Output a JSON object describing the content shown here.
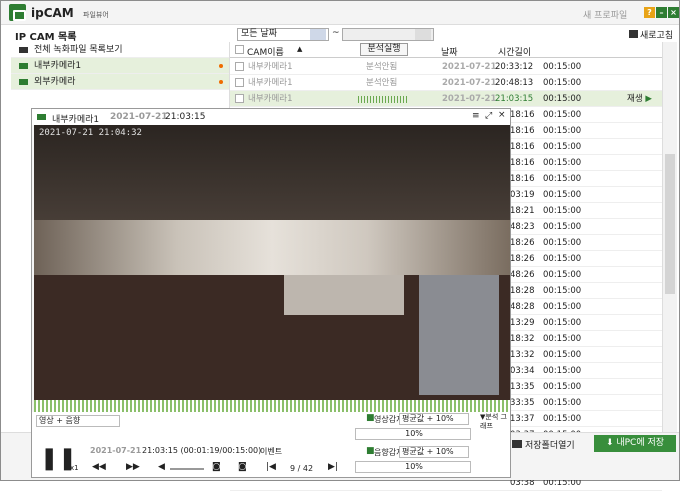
{
  "app": {
    "name": "ipCAM",
    "subtitle": "파일뷰어",
    "new_program": "새 프로파일"
  },
  "toolbar": {
    "list_label": "IP CAM 목록",
    "date_filter": "모든 날짜",
    "tilde": "~",
    "refresh": "새로고침"
  },
  "cameras": [
    {
      "label": "전체 녹화파일 목록보기",
      "selected": false
    },
    {
      "label": "내부카메라1",
      "selected": true
    },
    {
      "label": "외부카메라",
      "selected": true
    }
  ],
  "table": {
    "col_cam": "CAM이름",
    "col_analysis": "분석실행",
    "col_date": "날짜",
    "col_length": "시간길이"
  },
  "rows": [
    {
      "cam": "내부카메라1",
      "analysis": "분석안됨",
      "date": "2021-07-21",
      "time": "20:33:12",
      "length": "00:15:00"
    },
    {
      "cam": "내부카메라1",
      "analysis": "분석안됨",
      "date": "2021-07-21",
      "time": "20:48:13",
      "length": "00:15:00"
    },
    {
      "cam": "내부카메라1",
      "analysis": "",
      "date": "2021-07-21",
      "time": "21:03:15",
      "length": "00:15:00",
      "play": "재생"
    }
  ],
  "extra_times": [
    "18:16",
    "18:16",
    "18:16",
    "18:16",
    "18:16",
    "03:19",
    "18:21",
    "48:23",
    "18:26",
    "18:26",
    "48:26",
    "18:28",
    "48:28",
    "13:29",
    "18:32",
    "13:32",
    "03:34",
    "13:35",
    "33:35",
    "13:37",
    "03:37",
    "48:37",
    "03:38",
    "03:38"
  ],
  "extra_length": "00:15:00",
  "bottom": {
    "open_folder": "저장폴더열기",
    "save_pc": "내PC에 저장"
  },
  "player": {
    "cam": "내부카메라1",
    "date": "2021-07-21",
    "time": "21:03:15",
    "overlay": "2021-07-21  21:04:32",
    "mode": "영상 + 음향",
    "clock": "21:03:15 (00:01:19/00:15:00)",
    "event_label": "이벤트",
    "event_count": "9 / 42",
    "speed": "x1",
    "video_detect": "영상감지",
    "video_detect_val": "평균값 + 10%",
    "video_pct": "10%",
    "audio_detect": "음향감지",
    "audio_detect_val": "평균값 + 10%",
    "audio_pct": "10%",
    "analysis_graph": "▼분석 그래프"
  }
}
